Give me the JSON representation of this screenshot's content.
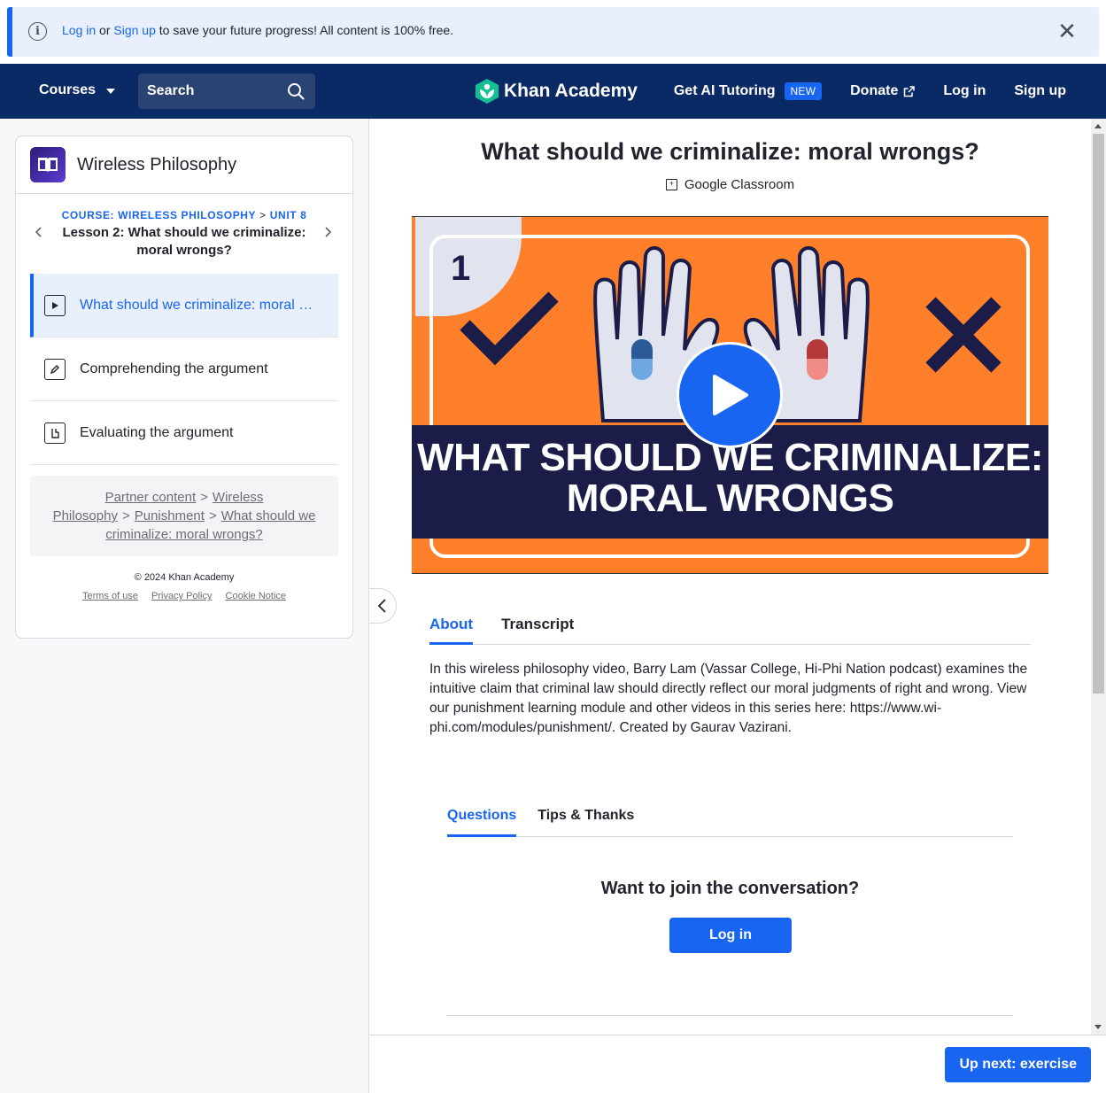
{
  "banner": {
    "login": "Log in",
    "or": " or ",
    "signup": "Sign up",
    "message": " to save your future progress! All content is 100% free."
  },
  "nav": {
    "courses": "Courses",
    "search_placeholder": "Search",
    "logo": "Khan Academy",
    "ai_tutoring": "Get AI Tutoring",
    "new_badge": "NEW",
    "donate": "Donate",
    "login": "Log in",
    "signup": "Sign up"
  },
  "sidebar": {
    "course_title": "Wireless Philosophy",
    "crumb_course": "COURSE: WIRELESS PHILOSOPHY",
    "crumb_sep": ">",
    "crumb_unit": "UNIT 8",
    "lesson_title": "Lesson 2: What should we criminalize: moral wrongs?",
    "items": [
      {
        "label": "What should we criminalize: moral wrongs?",
        "icon": "play-icon",
        "active": true
      },
      {
        "label": "Comprehending the argument",
        "icon": "pencil-icon",
        "active": false
      },
      {
        "label": "Evaluating the argument",
        "icon": "document-icon",
        "active": false
      }
    ],
    "partner": {
      "p1": "Partner content",
      "p2": "Wireless Philosophy",
      "p3": "Punishment",
      "p4": "What should we criminalize: moral wrongs?",
      "gt": ">"
    },
    "copyright": "© 2024 Khan Academy",
    "links": {
      "terms": "Terms of use",
      "privacy": "Privacy Policy",
      "cookie": "Cookie Notice"
    }
  },
  "main": {
    "title": "What should we criminalize: moral wrongs?",
    "google_classroom": "Google Classroom",
    "video": {
      "number": "1",
      "line1": "WHAT SHOULD WE CRIMINALIZE:",
      "line2": "MORAL WRONGS"
    },
    "tabs": [
      "About",
      "Transcript"
    ],
    "about_text": "In this wireless philosophy video, Barry Lam (Vassar College, Hi-Phi Nation podcast) examines the intuitive claim that criminal law should directly reflect our moral judgments of right and wrong. View our punishment learning module and other videos in this series here: https://www.wi-phi.com/modules/punishment/. Created by Gaurav Vazirani.",
    "qtabs": [
      "Questions",
      "Tips & Thanks"
    ],
    "join_text": "Want to join the conversation?",
    "login_button": "Log in"
  },
  "footer": {
    "next_button": "Up next: exercise"
  },
  "colors": {
    "accent": "#1865f2",
    "nav_bg": "#0a2a66",
    "video_orange": "#ff7f2a",
    "video_navy": "#1b1c48"
  }
}
